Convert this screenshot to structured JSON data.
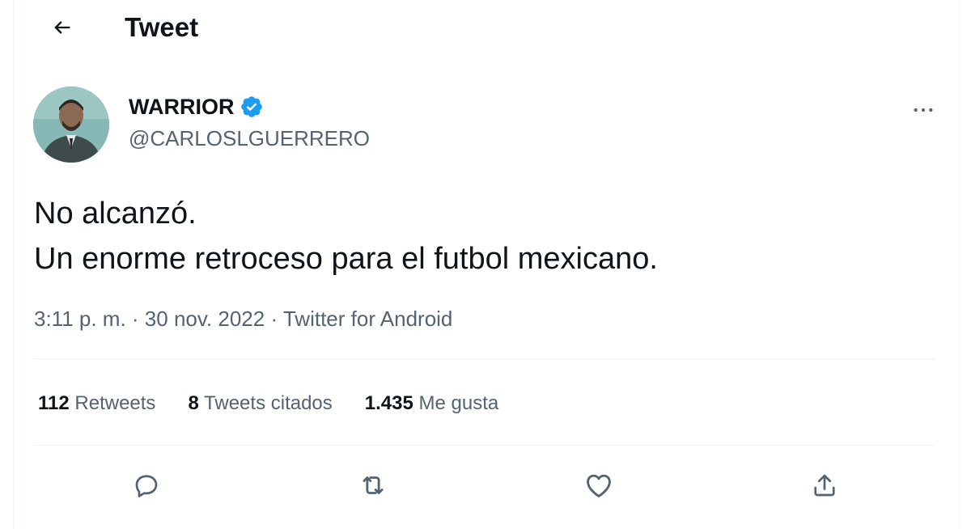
{
  "header": {
    "title": "Tweet",
    "back_icon": "arrow-left-icon"
  },
  "author": {
    "name": "WARRIOR",
    "handle": "@CARLOSLGUERRERO",
    "verified": true,
    "verified_color": "#1d9bf0",
    "avatar_bg": "#7fb3b0"
  },
  "tweet": {
    "lines": [
      "No alcanzó.",
      "Un enorme retroceso para el futbol mexicano."
    ]
  },
  "meta": {
    "time": "3:11 p. m.",
    "sep": " · ",
    "date": "30 nov. 2022",
    "source": "Twitter for Android"
  },
  "stats": {
    "retweets": {
      "count": "112",
      "label": "Retweets"
    },
    "quotes": {
      "count": "8",
      "label": "Tweets citados"
    },
    "likes": {
      "count": "1.435",
      "label": "Me gusta"
    }
  },
  "actions": [
    "reply-icon",
    "retweet-icon",
    "like-icon",
    "share-icon"
  ],
  "colors": {
    "text": "#0f1419",
    "secondary": "#536471",
    "divider": "#eff3f4"
  }
}
